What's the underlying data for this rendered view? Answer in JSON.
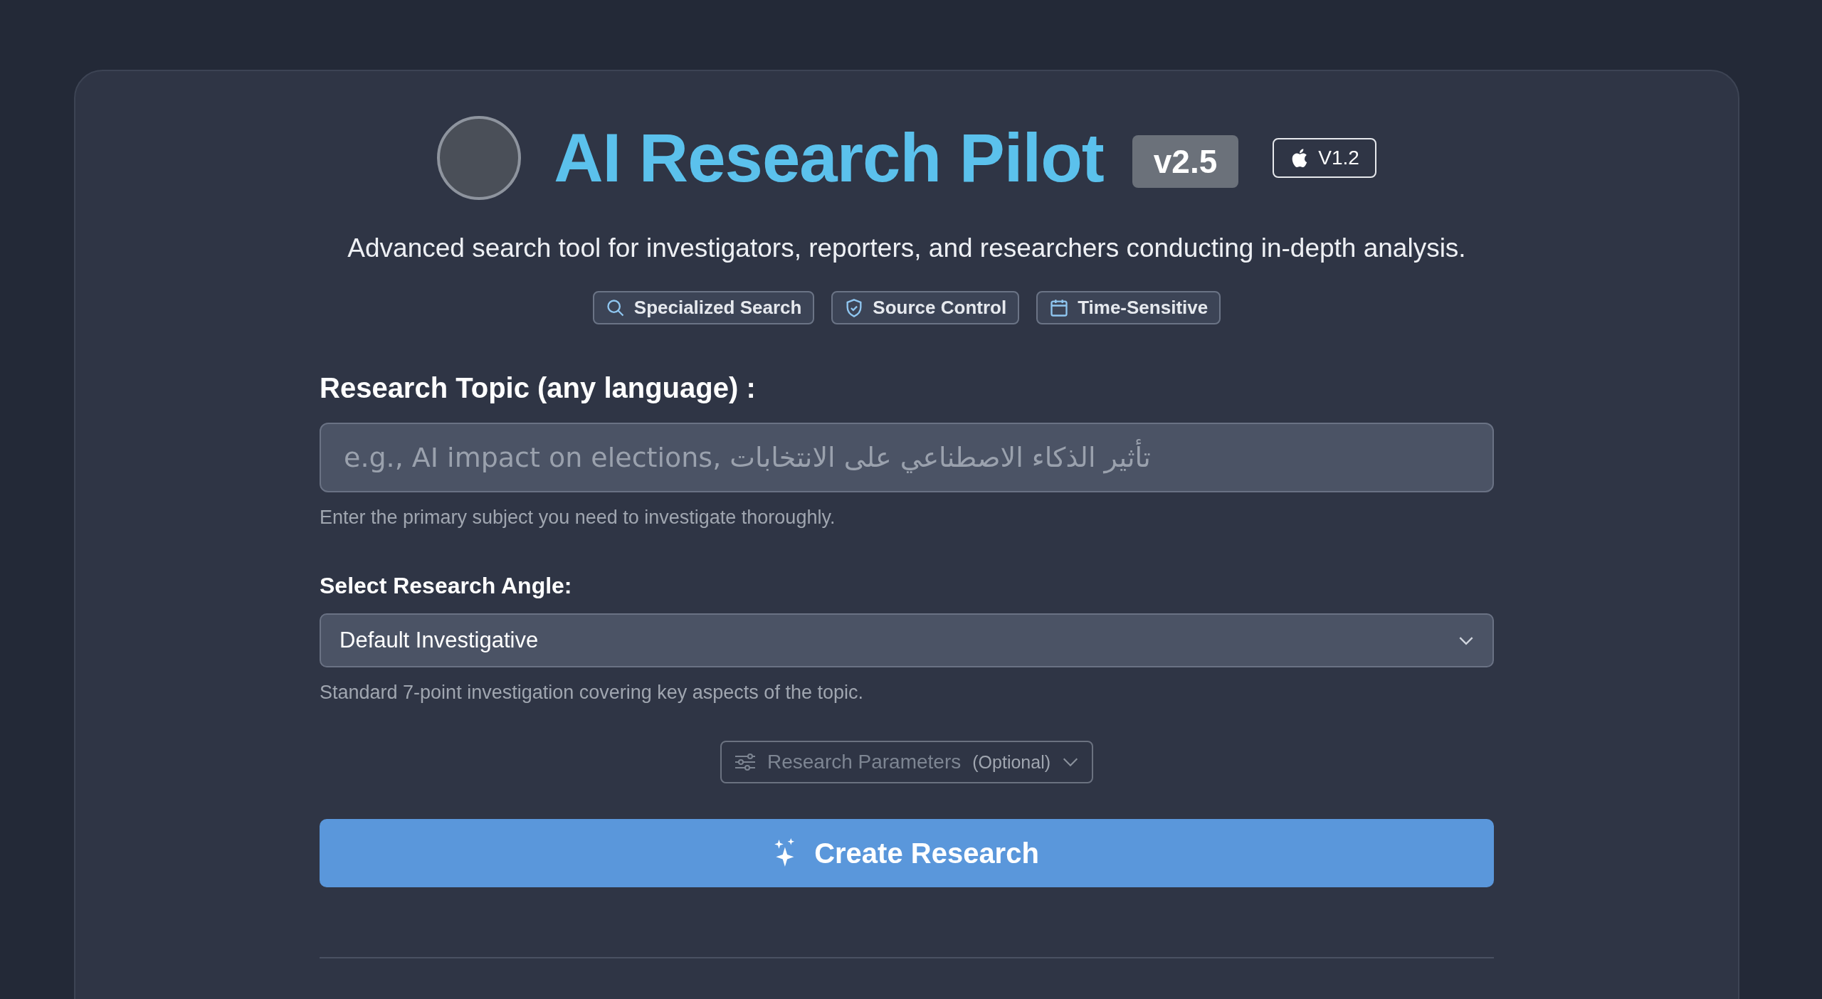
{
  "header": {
    "title": "AI Research Pilot",
    "version_badge": "v2.5",
    "platform_badge": "V1.2"
  },
  "subtitle": "Advanced search tool for investigators, reporters, and researchers conducting in-depth analysis.",
  "tags": [
    {
      "kind": "search",
      "label": "Specialized Search"
    },
    {
      "kind": "shield",
      "label": "Source Control"
    },
    {
      "kind": "calendar",
      "label": "Time-Sensitive"
    }
  ],
  "topic": {
    "label": "Research Topic (any language) :",
    "placeholder": "e.g., AI impact on elections, تأثير الذكاء الاصطناعي على الانتخابات",
    "help": "Enter the primary subject you need to investigate thoroughly."
  },
  "angle": {
    "label": "Select Research Angle:",
    "value": "Default Investigative",
    "help": "Standard 7-point investigation covering key aspects of the topic."
  },
  "parameters": {
    "label": "Research Parameters",
    "note": "(Optional)",
    "expanded": false
  },
  "submit": {
    "label": "Create Research"
  }
}
